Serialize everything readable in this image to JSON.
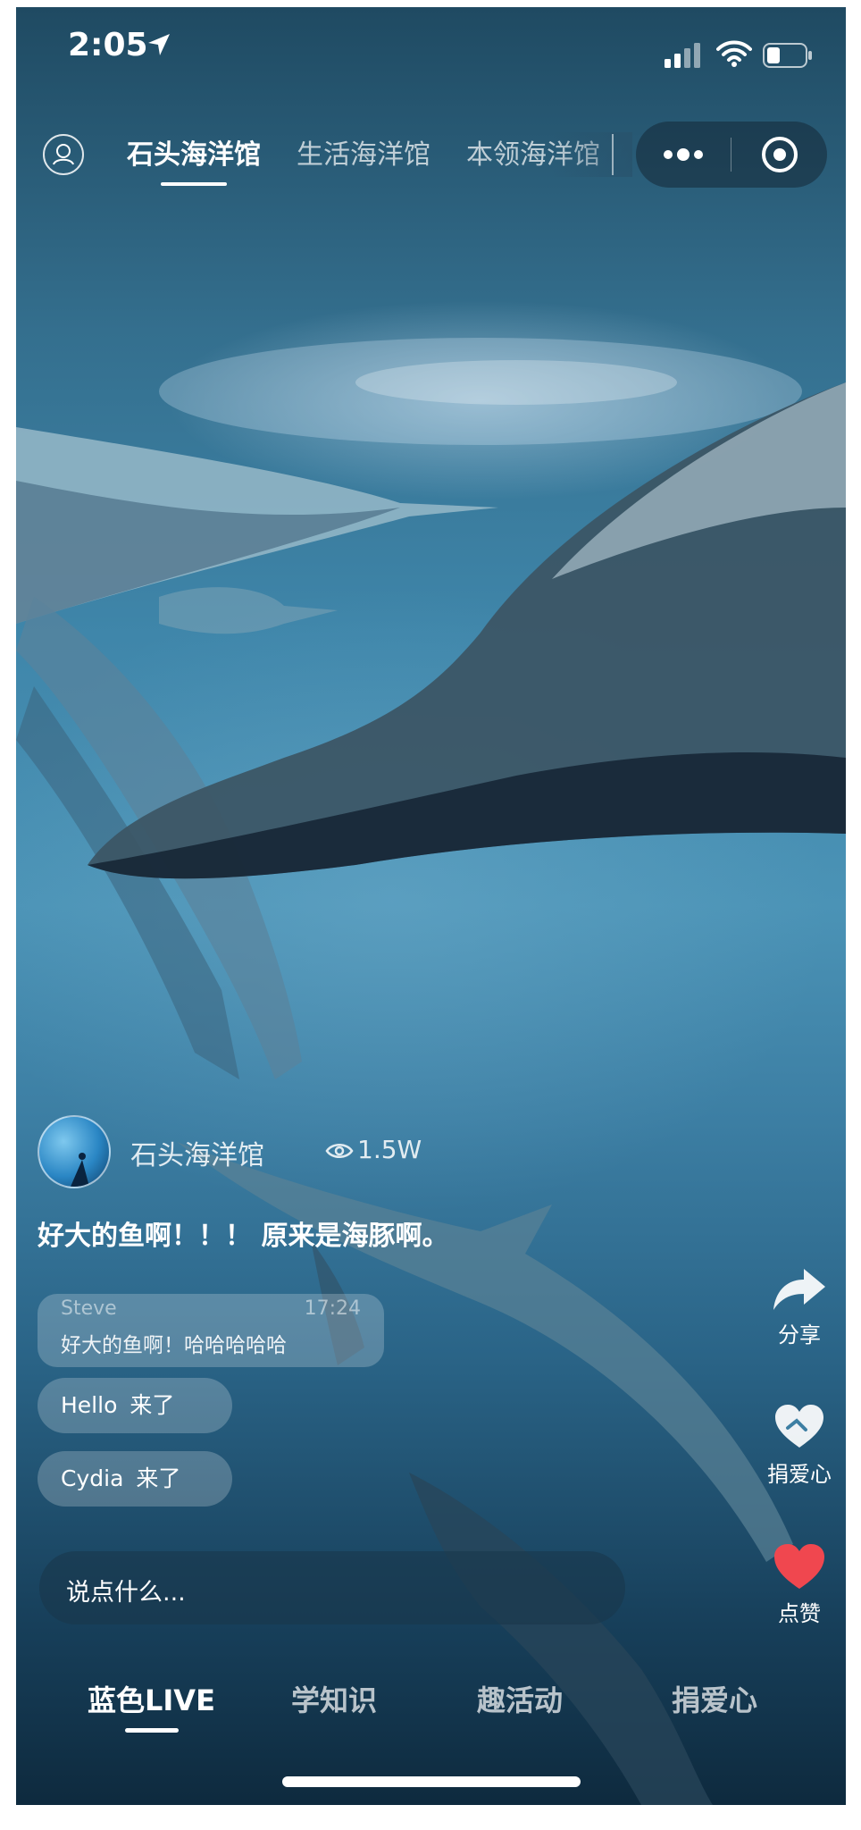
{
  "status": {
    "time": "2:05"
  },
  "top_nav": {
    "tabs": [
      {
        "label": "石头海洋馆",
        "active": true
      },
      {
        "label": "生活海洋馆",
        "active": false
      },
      {
        "label": "本领海洋馆",
        "active": false
      }
    ]
  },
  "post": {
    "author": "石头海洋馆",
    "views": "1.5W",
    "caption": "好大的鱼啊！！！ 原来是海豚啊。"
  },
  "comments": [
    {
      "user": "Steve",
      "time": "17:24",
      "text": "好大的鱼啊！哈哈哈哈哈"
    },
    {
      "user": "Hello",
      "text": "来了"
    },
    {
      "user": "Cydia",
      "text": "来了"
    }
  ],
  "input": {
    "placeholder": "说点什么..."
  },
  "side_actions": [
    {
      "label": "分享",
      "icon": "share-arrow-icon"
    },
    {
      "label": "捐爱心",
      "icon": "heart-hands-icon"
    },
    {
      "label": "点赞",
      "icon": "heart-icon"
    }
  ],
  "bottom_tabs": [
    {
      "label": "蓝色LIVE",
      "active": true
    },
    {
      "label": "学知识",
      "active": false
    },
    {
      "label": "趣活动",
      "active": false
    },
    {
      "label": "捐爱心",
      "active": false
    }
  ],
  "colors": {
    "like_red": "#f0474f",
    "accent_white": "#ffffff"
  }
}
